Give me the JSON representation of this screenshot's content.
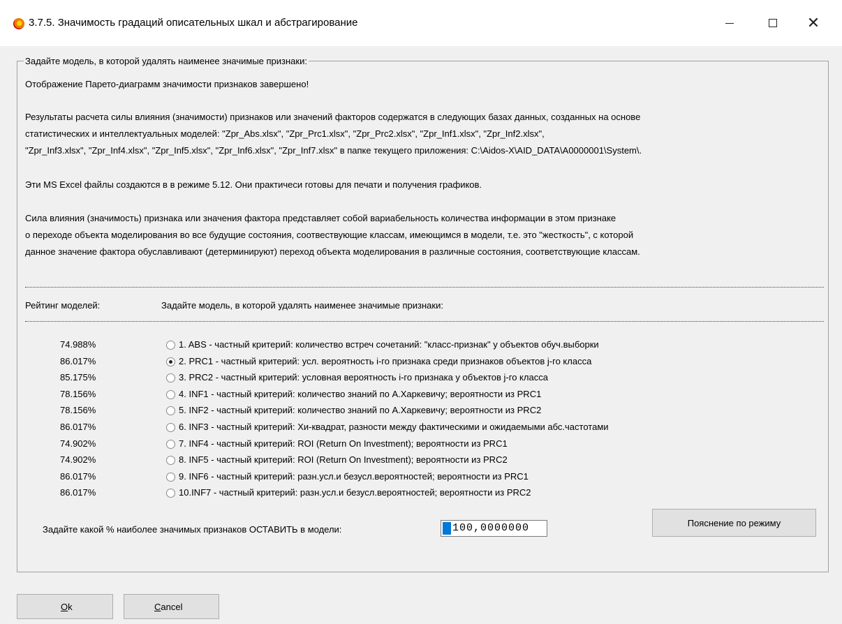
{
  "window": {
    "title": "3.7.5. Значимость градаций описательных шкал и абстрагирование",
    "icon": "aidos-app-icon"
  },
  "group": {
    "legend": "Задайте модель, в которой удалять наименее значимые признаки:",
    "message_lines": [
      "Отображение Парето-диаграмм значимости признаков завершено!",
      "Результаты расчета силы влияния (значимости) признаков или значений факторов содержатся в следующих базах данных, созданных на основе",
      "статистических и интеллектуальных моделей: \"Zpr_Abs.xlsx\", \"Zpr_Prc1.xlsx\", \"Zpr_Prc2.xlsx\", \"Zpr_Inf1.xlsx\", \"Zpr_Inf2.xlsx\",",
      "\"Zpr_Inf3.xlsx\", \"Zpr_Inf4.xlsx\", \"Zpr_Inf5.xlsx\", \"Zpr_Inf6.xlsx\", \"Zpr_Inf7.xlsx\" в папке текущего приложения: C:\\Aidos-X\\AID_DATA\\A0000001\\System\\.",
      "Эти MS Excel файлы создаются в в режиме 5.12. Они практичеси готовы для печати и получения графиков.",
      "Сила влияния (значимость) признака или значения фактора представляет собой вариабельность количества информации в этом признаке",
      "о переходе объекта моделирования во все будущие состояния, соотвествующие классам, имеющимся в модели, т.е. это \"жесткость\", с которой",
      "данное значение фактора обуславливают (детерминируют) переход объекта моделирования в различные состояния, соответствующие классам."
    ],
    "rating_header": "Рейтинг моделей:",
    "select_header": "Задайте модель, в которой удалять наименее значимые признаки:",
    "models": [
      {
        "pct": "74.988%",
        "label": "1. ABS  - частный критерий: количество встреч сочетаний: \"класс-признак\" у объектов обуч.выборки",
        "checked": false
      },
      {
        "pct": "86.017%",
        "label": "2. PRC1 - частный критерий: усл. вероятность i-го признака среди признаков объектов j-го класса",
        "checked": true
      },
      {
        "pct": "85.175%",
        "label": "3. PRC2 - частный критерий: условная вероятность i-го признака у объектов j-го класса",
        "checked": false
      },
      {
        "pct": "78.156%",
        "label": "4. INF1 - частный критерий: количество знаний по А.Харкевичу; вероятности из PRC1",
        "checked": false
      },
      {
        "pct": "78.156%",
        "label": "5. INF2 - частный критерий: количество знаний по А.Харкевичу; вероятности из PRC2",
        "checked": false
      },
      {
        "pct": "86.017%",
        "label": "6. INF3 - частный критерий: Хи-квадрат, разности между фактическими и ожидаемыми абс.частотами",
        "checked": false
      },
      {
        "pct": "74.902%",
        "label": "7. INF4 - частный критерий: ROI (Return On Investment); вероятности из PRC1",
        "checked": false
      },
      {
        "pct": "74.902%",
        "label": "8. INF5 - частный критерий: ROI (Return On Investment); вероятности из PRC2",
        "checked": false
      },
      {
        "pct": "86.017%",
        "label": "9. INF6 - частный критерий: разн.усл.и безусл.вероятностей; вероятности из PRC1",
        "checked": false
      },
      {
        "pct": "86.017%",
        "label": "10.INF7 - частный критерий: разн.усл.и безусл.вероятностей; вероятности из PRC2",
        "checked": false
      }
    ],
    "percent_prompt": "Задайте какой % наиболее значимых признаков ОСТАВИТЬ в модели:",
    "percent_value": "100,0000000",
    "explain_button": "Пояснение по режиму"
  },
  "buttons": {
    "ok_u": "O",
    "ok_rest": "k",
    "cancel_u": "C",
    "cancel_rest": "ancel"
  }
}
